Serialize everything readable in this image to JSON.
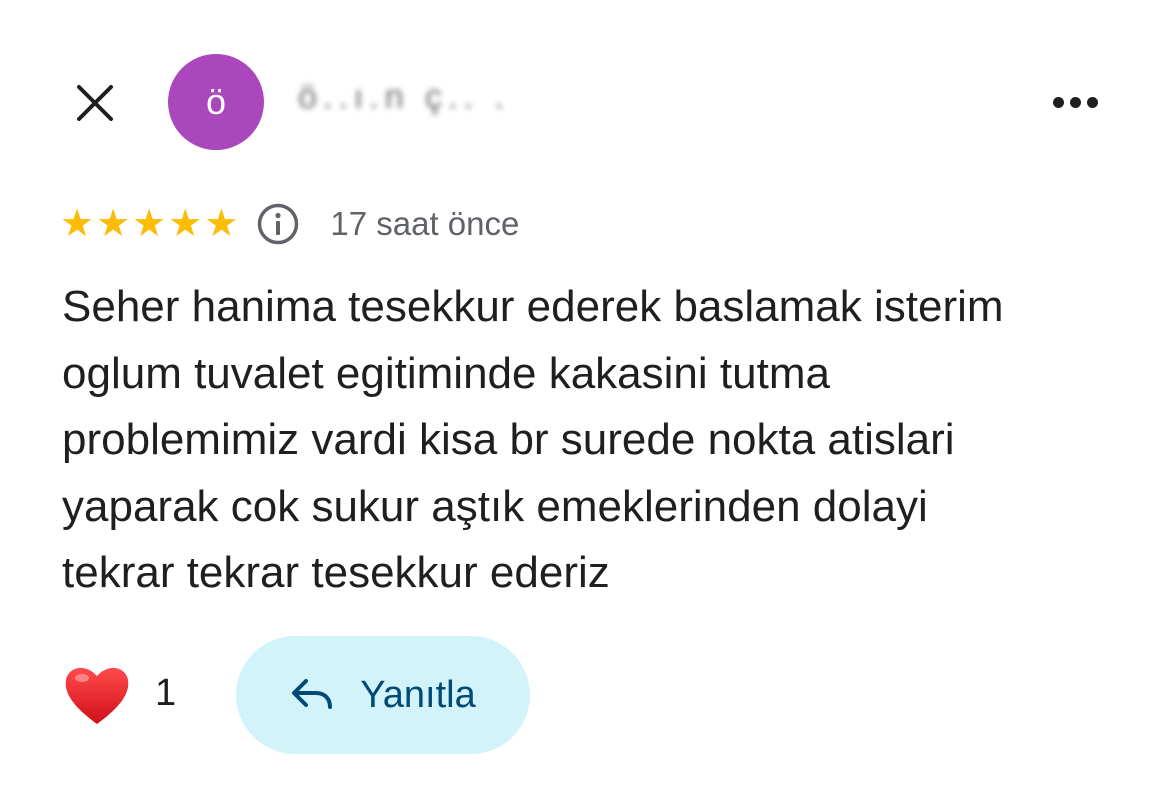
{
  "header": {
    "avatar_letter": "ö",
    "author_name": "ö..ı.n ç.. .",
    "avatar_color": "#ab47bc"
  },
  "icons": {
    "close": "close-icon",
    "more": "more-vert-icon",
    "info": "info-icon",
    "heart": "heart-icon",
    "reply": "reply-arrow-icon"
  },
  "review": {
    "rating": 5,
    "max_rating": 5,
    "time_ago": "17 saat önce",
    "text_lines": [
      "Seher hanima tesekkur ederek baslamak isterim",
      "oglum tuvalet egitiminde kakasini tutma",
      "problemimiz vardi kisa br surede nokta atislari",
      "yaparak cok sukur aştık emeklerinden dolayi",
      "tekrar tekrar tesekkur ederiz"
    ]
  },
  "actions": {
    "like_count": "1",
    "reply_label": "Yanıtla",
    "reply_bg": "#d3f3fb",
    "star_color": "#fbbc04",
    "heart_color": "#e0161f"
  }
}
